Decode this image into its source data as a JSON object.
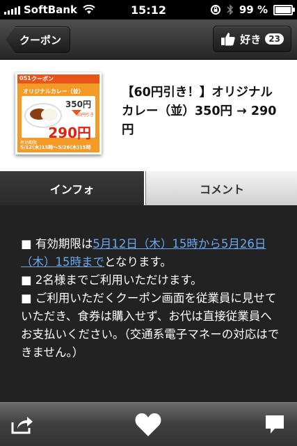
{
  "status_bar": {
    "carrier": "SoftBank",
    "time": "15:12",
    "battery": "99 %",
    "battery_level": 0.99
  },
  "nav": {
    "back_label": "クーポン",
    "like_label": "好き",
    "like_count": "23"
  },
  "item": {
    "title": "【60円引き！】オリジナルカレー（並）350円 → 290円",
    "thumbnail": {
      "no": "051",
      "header": "クーポン",
      "name": "オリジナルカレー（並）",
      "old_price": "350円",
      "discount": "60円引き",
      "new_price": "290円",
      "period_label": "有効期限",
      "period": "5/12(木)15時〜5/26(木)15時"
    }
  },
  "tabs": [
    {
      "label": "インフォ",
      "selected": true
    },
    {
      "label": "コメント",
      "selected": false
    }
  ],
  "info": {
    "line1_prefix": "■ 有効期限は",
    "line1_link": "5月12日（木）15時から5月26日（木）15時まで",
    "line1_suffix": "となります。",
    "line2": "■ 2名様までご利用いただけます。",
    "line3": "■ ご利用いただくクーポン画面を従業員に見せていただき、食券は購入せず、お代は直接従業員へお支払いください。（交通系電子マネーの対応はできません。）"
  },
  "toolbar": {
    "icons": [
      "share-icon",
      "heart-icon",
      "comment-icon"
    ]
  },
  "colors": {
    "link": "#6aa8f2",
    "thumbnail_orange": "#f39a27",
    "price_red": "#e0220f"
  }
}
